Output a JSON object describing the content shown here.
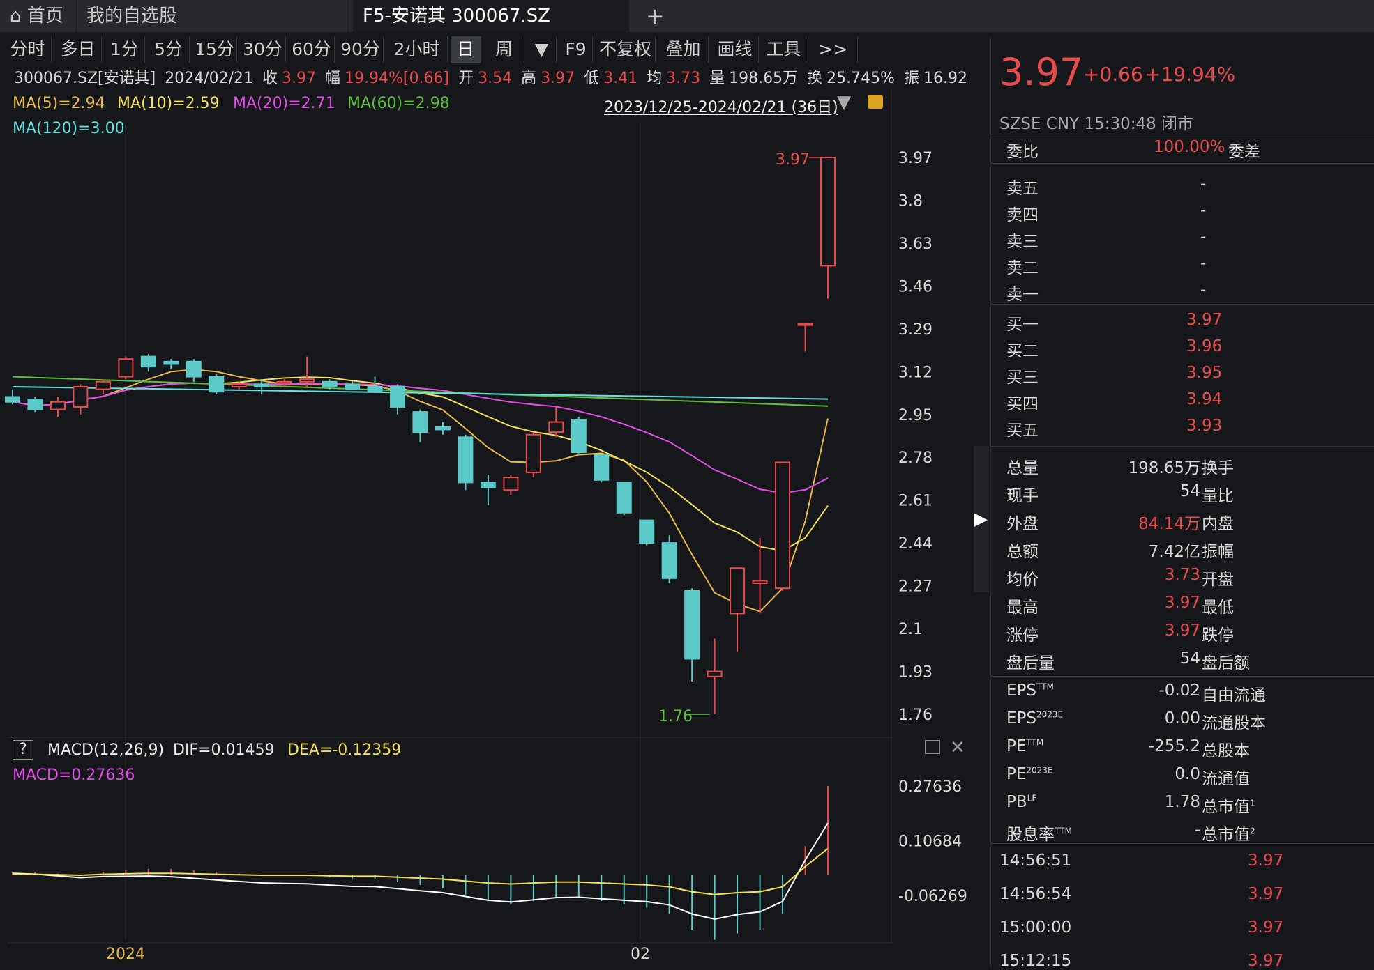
{
  "tabs": [
    {
      "label": "首页",
      "icon": "home-icon"
    },
    {
      "label": "我的自选股"
    },
    {
      "label": "F5-安诺其 300067.SZ"
    }
  ],
  "add_tab_label": "+",
  "toolbar": [
    "分时",
    "多日",
    "1分",
    "5分",
    "15分",
    "30分",
    "60分",
    "90分",
    "2小时",
    "日",
    "周",
    "▼",
    "F9",
    "不复权",
    "叠加",
    "画线",
    "工具",
    ">>"
  ],
  "toolbar_active": "日",
  "info": {
    "code": "300067.SZ[安诺其]",
    "date": "2024/02/21",
    "close_label": "收",
    "close": "3.97",
    "chg_label": "幅",
    "chg": "19.94%[0.66]",
    "open_label": "开",
    "open": "3.54",
    "high_label": "高",
    "high": "3.97",
    "low_label": "低",
    "low": "3.41",
    "avg_label": "均",
    "avg": "3.73",
    "vol_label": "量",
    "vol": "198.65万",
    "turn_label": "换",
    "turn": "25.745%",
    "amp_label": "振",
    "amp": "16.92"
  },
  "ma": {
    "ma5": "MA(5)=2.94",
    "ma10": "MA(10)=2.59",
    "ma20": "MA(20)=2.71",
    "ma60": "MA(60)=2.98",
    "ma120": "MA(120)=3.00"
  },
  "colors": {
    "ma5": "#e8b84a",
    "ma10": "#f5e05a",
    "ma20": "#e24de6",
    "ma60": "#5fbf3f",
    "ma120": "#66e0e0",
    "up": "#e84b4b",
    "down": "#5ccac8",
    "bg": "#16171b"
  },
  "range_label": "2023/12/25-2024/02/21 (36日)",
  "price_axis": [
    "3.97",
    "3.8",
    "3.63",
    "3.46",
    "3.29",
    "3.12",
    "2.95",
    "2.78",
    "2.61",
    "2.44",
    "2.27",
    "2.1",
    "1.93",
    "1.76"
  ],
  "max_marker": "3.97",
  "min_marker": "1.76",
  "macd": {
    "title": "MACD(12,26,9)",
    "dif": "DIF=0.01459",
    "dea": "DEA=-0.12359",
    "macd": "MACD=0.27636",
    "help": "?"
  },
  "macd_axis": [
    "0.27636",
    "0.10684",
    "-0.06269"
  ],
  "x_labels": [
    "2024",
    "02"
  ],
  "chart_data": {
    "type": "candlestick",
    "ylim": [
      1.76,
      3.97
    ],
    "candles": [
      {
        "o": 3.02,
        "h": 3.05,
        "l": 2.99,
        "c": 3.0
      },
      {
        "o": 3.01,
        "h": 3.02,
        "l": 2.96,
        "c": 2.97
      },
      {
        "o": 2.97,
        "h": 3.02,
        "l": 2.94,
        "c": 3.0
      },
      {
        "o": 2.98,
        "h": 3.07,
        "l": 2.95,
        "c": 3.06
      },
      {
        "o": 3.05,
        "h": 3.09,
        "l": 3.03,
        "c": 3.08
      },
      {
        "o": 3.1,
        "h": 3.18,
        "l": 3.09,
        "c": 3.17
      },
      {
        "o": 3.18,
        "h": 3.19,
        "l": 3.12,
        "c": 3.14
      },
      {
        "o": 3.16,
        "h": 3.17,
        "l": 3.13,
        "c": 3.15
      },
      {
        "o": 3.16,
        "h": 3.17,
        "l": 3.08,
        "c": 3.1
      },
      {
        "o": 3.1,
        "h": 3.11,
        "l": 3.03,
        "c": 3.04
      },
      {
        "o": 3.06,
        "h": 3.08,
        "l": 3.05,
        "c": 3.07
      },
      {
        "o": 3.07,
        "h": 3.09,
        "l": 3.03,
        "c": 3.06
      },
      {
        "o": 3.08,
        "h": 3.09,
        "l": 3.06,
        "c": 3.08
      },
      {
        "o": 3.08,
        "h": 3.18,
        "l": 3.06,
        "c": 3.09
      },
      {
        "o": 3.08,
        "h": 3.09,
        "l": 3.05,
        "c": 3.06
      },
      {
        "o": 3.07,
        "h": 3.08,
        "l": 3.05,
        "c": 3.05
      },
      {
        "o": 3.06,
        "h": 3.1,
        "l": 3.04,
        "c": 3.04
      },
      {
        "o": 3.06,
        "h": 3.07,
        "l": 2.95,
        "c": 2.98
      },
      {
        "o": 2.96,
        "h": 2.97,
        "l": 2.84,
        "c": 2.88
      },
      {
        "o": 2.9,
        "h": 2.92,
        "l": 2.87,
        "c": 2.89
      },
      {
        "o": 2.86,
        "h": 2.87,
        "l": 2.65,
        "c": 2.68
      },
      {
        "o": 2.68,
        "h": 2.71,
        "l": 2.59,
        "c": 2.66
      },
      {
        "o": 2.65,
        "h": 2.71,
        "l": 2.63,
        "c": 2.7
      },
      {
        "o": 2.72,
        "h": 2.88,
        "l": 2.7,
        "c": 2.87
      },
      {
        "o": 2.88,
        "h": 2.98,
        "l": 2.86,
        "c": 2.92
      },
      {
        "o": 2.93,
        "h": 2.94,
        "l": 2.79,
        "c": 2.8
      },
      {
        "o": 2.79,
        "h": 2.79,
        "l": 2.68,
        "c": 2.69
      },
      {
        "o": 2.68,
        "h": 2.68,
        "l": 2.55,
        "c": 2.56
      },
      {
        "o": 2.53,
        "h": 2.53,
        "l": 2.43,
        "c": 2.44
      },
      {
        "o": 2.44,
        "h": 2.47,
        "l": 2.28,
        "c": 2.3
      },
      {
        "o": 2.25,
        "h": 2.26,
        "l": 1.89,
        "c": 1.98
      },
      {
        "o": 1.91,
        "h": 2.06,
        "l": 1.76,
        "c": 1.93
      },
      {
        "o": 2.16,
        "h": 2.34,
        "l": 2.01,
        "c": 2.34
      },
      {
        "o": 2.28,
        "h": 2.46,
        "l": 2.16,
        "c": 2.29
      },
      {
        "o": 2.26,
        "h": 2.76,
        "l": 2.25,
        "c": 2.76
      },
      {
        "o": 3.31,
        "h": 3.31,
        "l": 3.2,
        "c": 3.31
      },
      {
        "o": 3.54,
        "h": 3.97,
        "l": 3.41,
        "c": 3.97
      }
    ],
    "macd_hist": [
      0.01,
      0.01,
      0.005,
      0.0,
      0.01,
      0.015,
      0.02,
      0.02,
      0.015,
      0.01,
      0.005,
      0.0,
      0.0,
      0.0,
      -0.005,
      -0.01,
      -0.01,
      -0.02,
      -0.03,
      -0.04,
      -0.06,
      -0.08,
      -0.09,
      -0.08,
      -0.07,
      -0.07,
      -0.08,
      -0.09,
      -0.1,
      -0.12,
      -0.17,
      -0.2,
      -0.18,
      -0.17,
      -0.12,
      0.09,
      0.27636
    ]
  },
  "right": {
    "price": "3.97",
    "change": "+0.66",
    "change_pct": "+19.94%",
    "meta": "SZSE  CNY  15:30:48  闭市",
    "weibi_label": "委比",
    "weibi": "100.00%",
    "weicha_label": "委差",
    "asks": [
      {
        "l": "卖五",
        "v": "-"
      },
      {
        "l": "卖四",
        "v": "-"
      },
      {
        "l": "卖三",
        "v": "-"
      },
      {
        "l": "卖二",
        "v": "-"
      },
      {
        "l": "卖一",
        "v": "-"
      }
    ],
    "bids": [
      {
        "l": "买一",
        "v": "3.97"
      },
      {
        "l": "买二",
        "v": "3.96"
      },
      {
        "l": "买三",
        "v": "3.95"
      },
      {
        "l": "买四",
        "v": "3.94"
      },
      {
        "l": "买五",
        "v": "3.93"
      }
    ],
    "stats": [
      {
        "l": "总量",
        "v": "198.65万",
        "l2": "换手",
        "red": false
      },
      {
        "l": "现手",
        "v": "54",
        "l2": "量比",
        "red": false
      },
      {
        "l": "外盘",
        "v": "84.14万",
        "l2": "内盘",
        "red": true
      },
      {
        "l": "总额",
        "v": "7.42亿",
        "l2": "振幅",
        "red": false
      },
      {
        "l": "均价",
        "v": "3.73",
        "l2": "开盘",
        "red": true
      },
      {
        "l": "最高",
        "v": "3.97",
        "l2": "最低",
        "red": true
      },
      {
        "l": "涨停",
        "v": "3.97",
        "l2": "跌停",
        "red": true
      },
      {
        "l": "盘后量",
        "v": "54",
        "l2": "盘后额",
        "red": false
      }
    ],
    "fin": [
      {
        "l": "EPS",
        "sup": "TTM",
        "v": "-0.02",
        "l2": "自由流通",
        "sup2": ""
      },
      {
        "l": "EPS",
        "sup": "2023E",
        "v": "0.00",
        "l2": "流通股本",
        "sup2": ""
      },
      {
        "l": "PE",
        "sup": "TTM",
        "v": "-255.2",
        "l2": "总股本",
        "sup2": ""
      },
      {
        "l": "PE",
        "sup": "2023E",
        "v": "0.0",
        "l2": "流通值",
        "sup2": ""
      },
      {
        "l": "PB",
        "sup": "LF",
        "v": "1.78",
        "l2": "总市值",
        "sup2": "1"
      },
      {
        "l": "股息率",
        "sup": "TTM",
        "v": "-",
        "l2": "总市值",
        "sup2": "2"
      }
    ],
    "trades": [
      {
        "t": "14:56:51",
        "p": "3.97"
      },
      {
        "t": "14:56:54",
        "p": "3.97"
      },
      {
        "t": "15:00:00",
        "p": "3.97"
      },
      {
        "t": "15:12:15",
        "p": "3.97"
      }
    ]
  }
}
